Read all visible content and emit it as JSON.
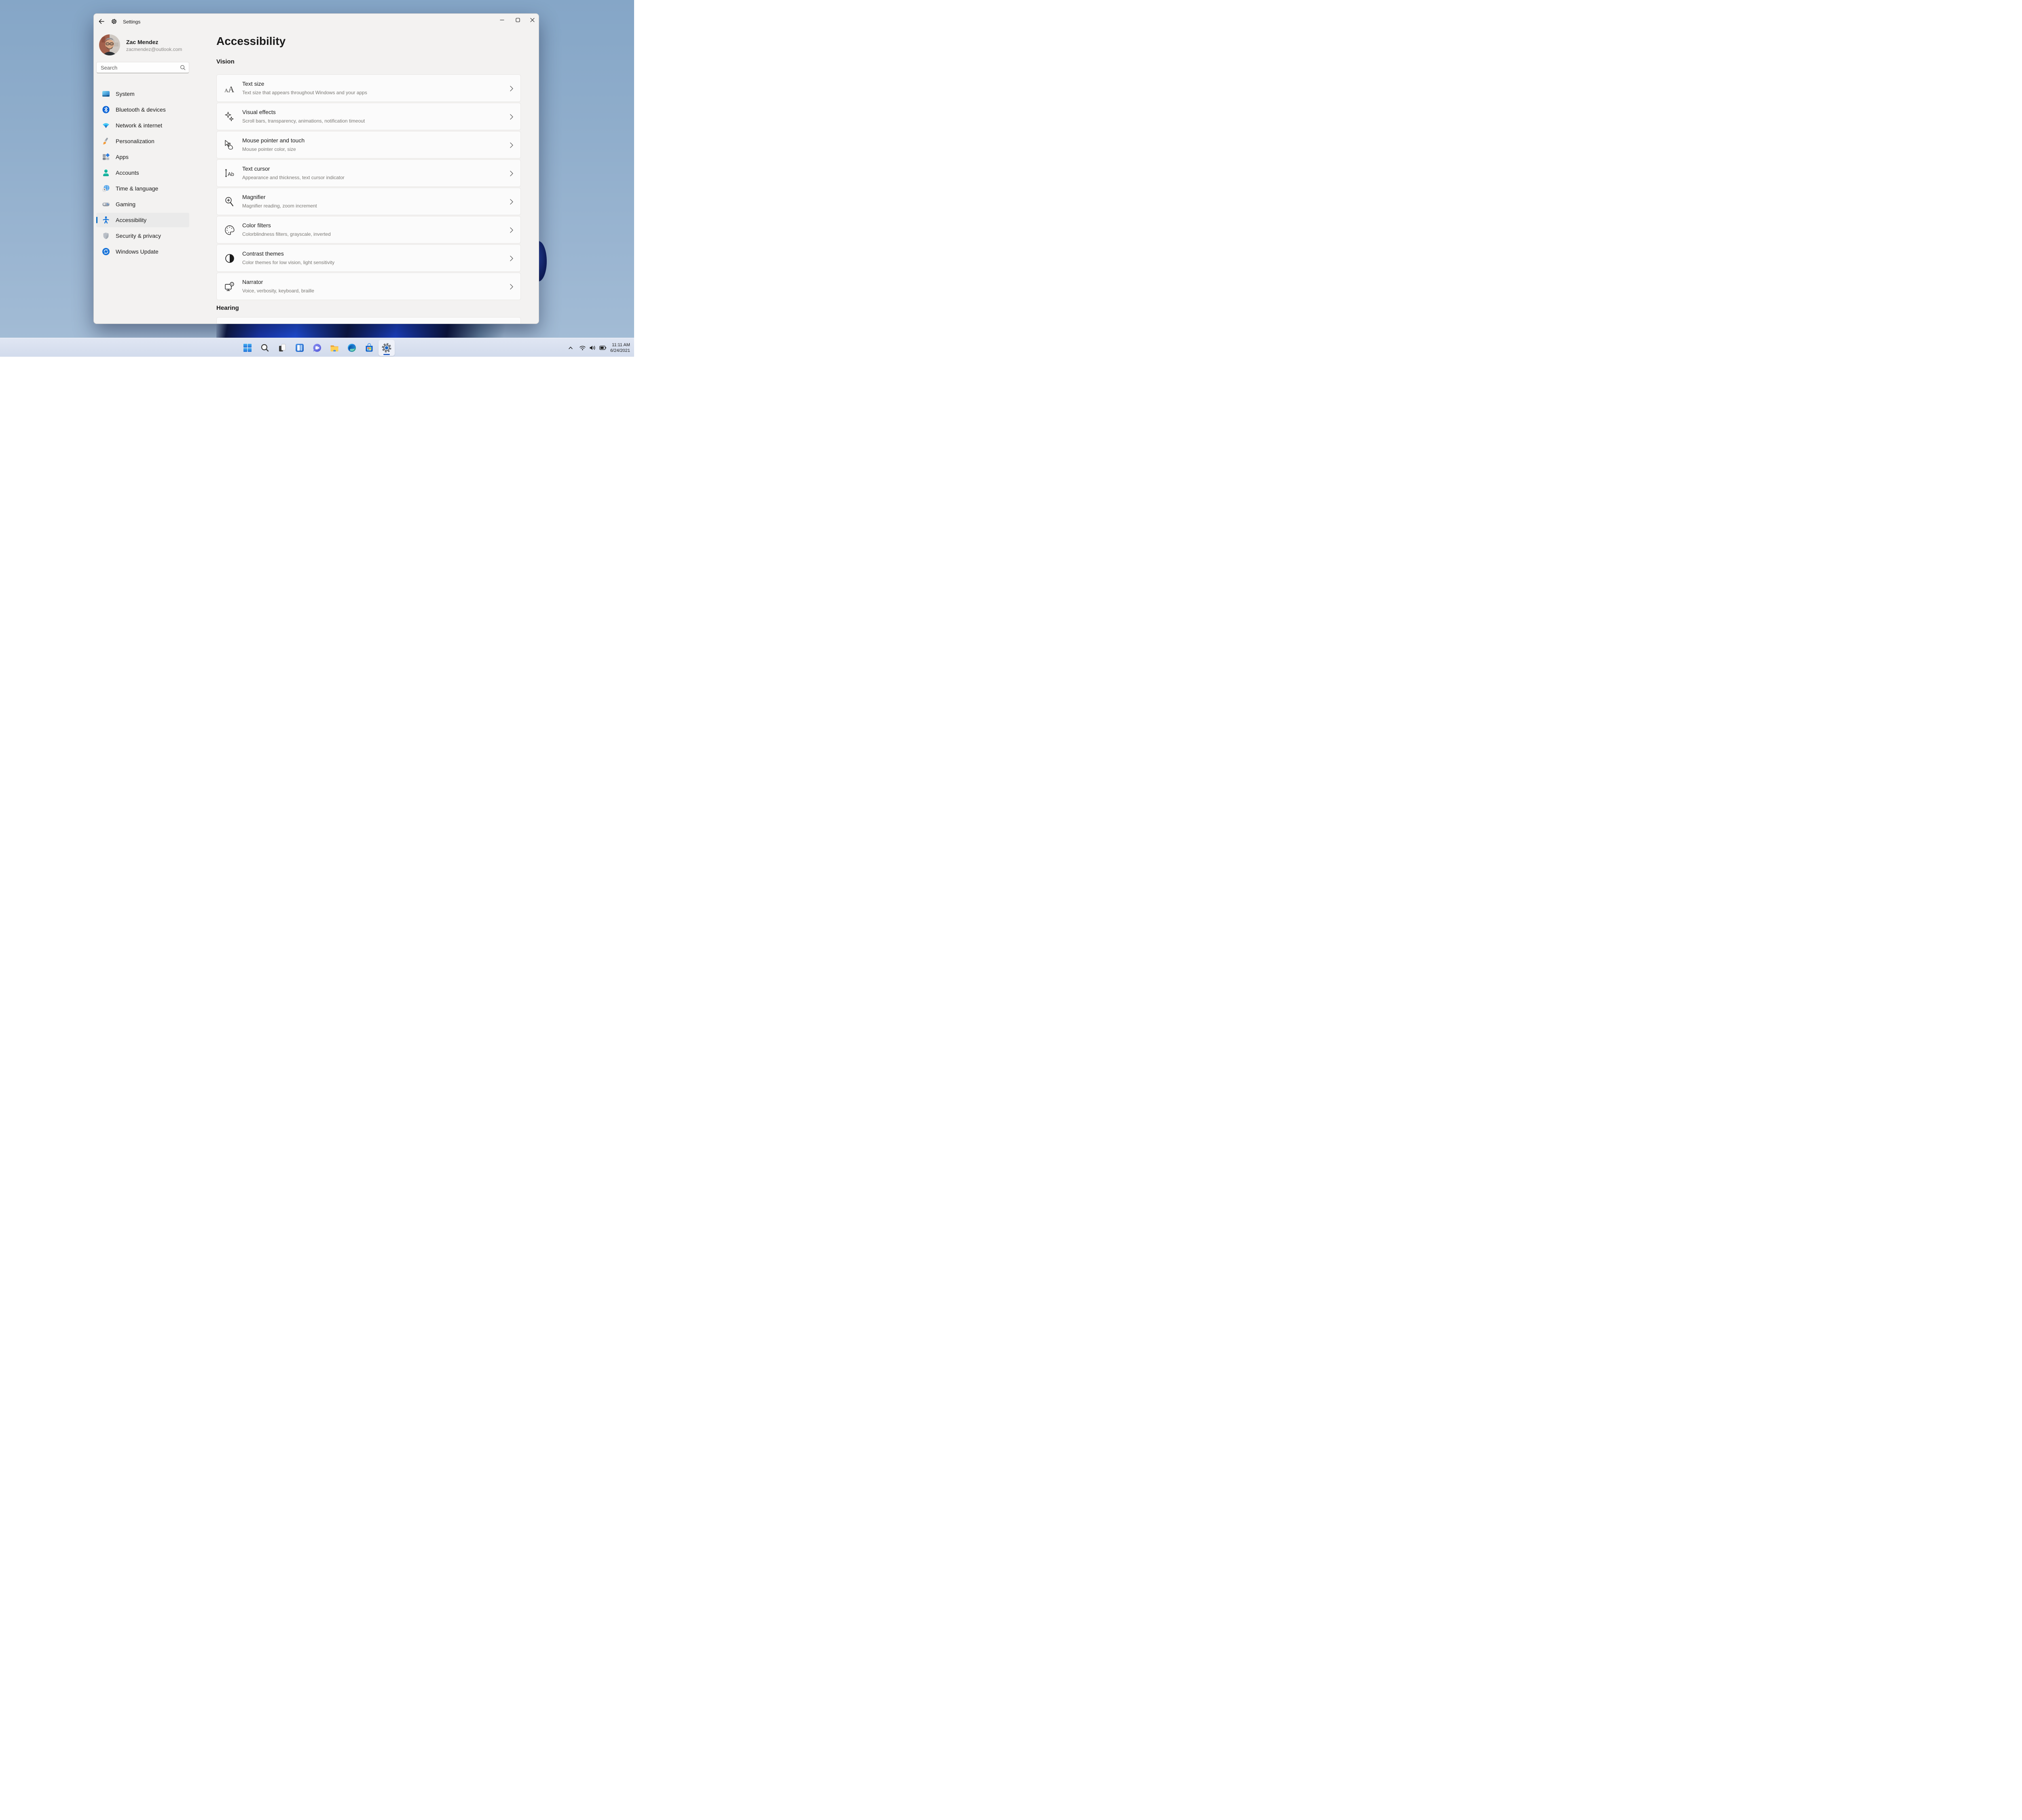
{
  "window": {
    "title": "Settings",
    "controls": {
      "minimize": "Minimize",
      "maximize": "Maximize",
      "close": "Close"
    },
    "user": {
      "name": "Zac Mendez",
      "email": "zacmendez@outlook.com"
    },
    "search": {
      "placeholder": "Search"
    },
    "sidebar": {
      "selected": "Accessibility",
      "items": [
        {
          "label": "System",
          "icon": "system-icon"
        },
        {
          "label": "Bluetooth & devices",
          "icon": "bluetooth-icon"
        },
        {
          "label": "Network & internet",
          "icon": "network-icon"
        },
        {
          "label": "Personalization",
          "icon": "personalization-icon"
        },
        {
          "label": "Apps",
          "icon": "apps-icon"
        },
        {
          "label": "Accounts",
          "icon": "accounts-icon"
        },
        {
          "label": "Time & language",
          "icon": "time-language-icon"
        },
        {
          "label": "Gaming",
          "icon": "gaming-icon"
        },
        {
          "label": "Accessibility",
          "icon": "accessibility-icon"
        },
        {
          "label": "Security & privacy",
          "icon": "security-icon"
        },
        {
          "label": "Windows Update",
          "icon": "windows-update-icon"
        }
      ]
    },
    "page": {
      "title": "Accessibility",
      "sections": [
        {
          "heading": "Vision",
          "cards": [
            {
              "title": "Text size",
              "subtitle": "Text size that appears throughout Windows and your apps",
              "icon": "text-size-icon"
            },
            {
              "title": "Visual effects",
              "subtitle": "Scroll bars, transparency, animations, notification timeout",
              "icon": "visual-effects-icon"
            },
            {
              "title": "Mouse pointer and touch",
              "subtitle": "Mouse pointer color, size",
              "icon": "mouse-pointer-icon"
            },
            {
              "title": "Text cursor",
              "subtitle": "Appearance and thickness, text cursor indicator",
              "icon": "text-cursor-icon"
            },
            {
              "title": "Magnifier",
              "subtitle": "Magnifier reading, zoom increment",
              "icon": "magnifier-icon"
            },
            {
              "title": "Color filters",
              "subtitle": "Colorblindness filters, grayscale, inverted",
              "icon": "color-filters-icon"
            },
            {
              "title": "Contrast themes",
              "subtitle": "Color themes for low vision, light sensitivity",
              "icon": "contrast-themes-icon"
            },
            {
              "title": "Narrator",
              "subtitle": "Voice, verbosity, keyboard, braille",
              "icon": "narrator-icon"
            }
          ]
        },
        {
          "heading": "Hearing",
          "cards": []
        }
      ]
    }
  },
  "taskbar": {
    "items": [
      {
        "name": "start"
      },
      {
        "name": "search"
      },
      {
        "name": "task-view"
      },
      {
        "name": "widgets"
      },
      {
        "name": "chat"
      },
      {
        "name": "file-explorer"
      },
      {
        "name": "edge"
      },
      {
        "name": "microsoft-store"
      },
      {
        "name": "settings",
        "active": true
      }
    ],
    "tray": {
      "icons": [
        "hidden-icons-chevron",
        "wifi",
        "volume",
        "battery"
      ],
      "time": "11:11 AM",
      "date": "6/24/2021"
    }
  },
  "colors": {
    "accent": "#0067C0",
    "window_bg": "#F3F2F1",
    "card_bg": "#FBFBFB",
    "taskbar_bg": "#D5DEEE",
    "desktop": "#93B1CE",
    "bloom_navy": "#0D1742",
    "bloom_blue": "#1D45D2"
  }
}
